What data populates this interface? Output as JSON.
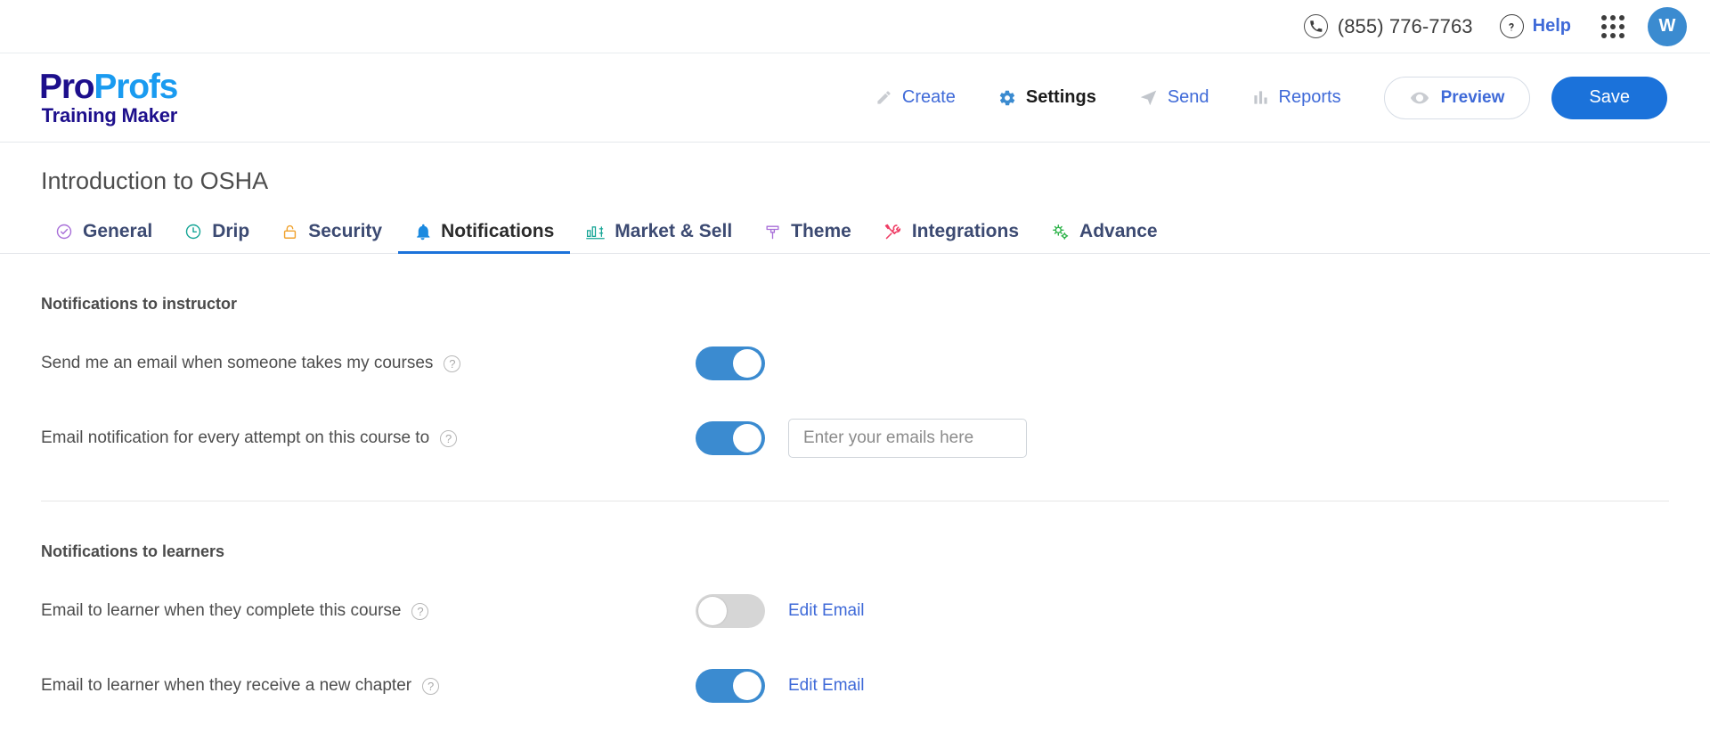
{
  "topbar": {
    "phone_icon": "phone-circle-icon",
    "phone": "(855) 776-7763",
    "help_icon": "question-circle-icon",
    "help": "Help",
    "apps_icon": "grid-apps-icon",
    "avatar_initial": "W"
  },
  "brand": {
    "name_part1": "Pro",
    "name_part2": "Profs",
    "tagline": "Training Maker",
    "color_dark": "#1d0f8c",
    "color_light": "#1a9bf0"
  },
  "mainnav": {
    "items": [
      {
        "label": "Create",
        "icon": "pencil-icon",
        "active": false
      },
      {
        "label": "Settings",
        "icon": "gear-icon",
        "active": true
      },
      {
        "label": "Send",
        "icon": "paper-plane-icon",
        "active": false
      },
      {
        "label": "Reports",
        "icon": "bar-chart-icon",
        "active": false
      }
    ],
    "preview_label": "Preview",
    "preview_icon": "eye-icon",
    "save_label": "Save",
    "save_color": "#1b72da"
  },
  "course": {
    "title": "Introduction to OSHA"
  },
  "tabs": [
    {
      "label": "General",
      "icon": "check-circle-icon",
      "icon_color": "#a86fd8",
      "active": false
    },
    {
      "label": "Drip",
      "icon": "clock-icon",
      "icon_color": "#16a596",
      "active": false
    },
    {
      "label": "Security",
      "icon": "lock-icon",
      "icon_color": "#f0a22e",
      "active": false
    },
    {
      "label": "Notifications",
      "icon": "bell-icon",
      "icon_color": "#1b8ae0",
      "active": true
    },
    {
      "label": "Market & Sell",
      "icon": "chart-dollar-icon",
      "icon_color": "#16a596",
      "active": false
    },
    {
      "label": "Theme",
      "icon": "paint-brush-icon",
      "icon_color": "#a86fd8",
      "active": false
    },
    {
      "label": "Integrations",
      "icon": "tools-icon",
      "icon_color": "#ef3d65",
      "active": false
    },
    {
      "label": "Advance",
      "icon": "gears-icon",
      "icon_color": "#2eb34a",
      "active": false
    }
  ],
  "instructor_section": {
    "title": "Notifications to instructor",
    "rows": [
      {
        "label": "Send me an email when someone takes my courses",
        "help_icon": "help-icon",
        "toggle_state": "on"
      },
      {
        "label": "Email notification for every attempt on this course to",
        "help_icon": "help-icon",
        "toggle_state": "on",
        "input_value": "",
        "input_placeholder": "Enter your emails here"
      }
    ]
  },
  "learners_section": {
    "title": "Notifications to learners",
    "rows": [
      {
        "label": "Email to learner when they complete this course",
        "help_icon": "help-icon",
        "toggle_state": "off",
        "edit_label": "Edit Email"
      },
      {
        "label": "Email to learner when they receive a new chapter",
        "help_icon": "help-icon",
        "toggle_state": "on",
        "edit_label": "Edit Email"
      }
    ]
  }
}
